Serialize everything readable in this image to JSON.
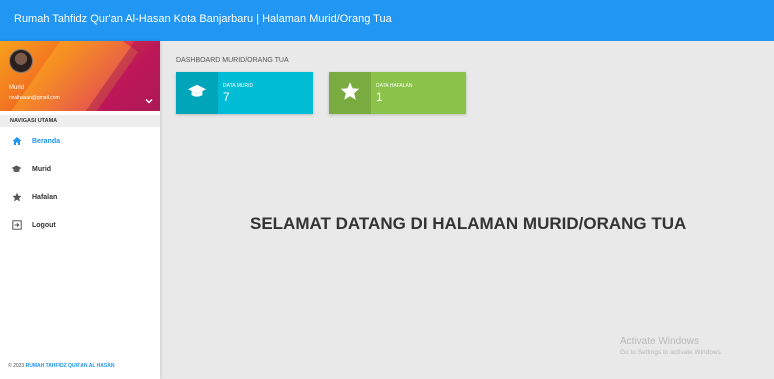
{
  "topbar": {
    "title": "Rumah Tahfidz Qur'an Al-Hasan Kota Banjarbaru | Halaman Murid/Orang Tua"
  },
  "user": {
    "name": "Murid",
    "email": "rizalhasan@gmail.com"
  },
  "nav": {
    "header": "NAVIGASI UTAMA",
    "items": [
      {
        "label": "Beranda",
        "icon": "home-icon",
        "active": true
      },
      {
        "label": "Murid",
        "icon": "graduation-cap-icon"
      },
      {
        "label": "Hafalan",
        "icon": "star-icon"
      },
      {
        "label": "Logout",
        "icon": "logout-icon"
      }
    ]
  },
  "footer": {
    "prefix": "© 2023 ",
    "brand": "RUMAH TAHFIDZ QUR'AN AL HASAN"
  },
  "main": {
    "heading": "DASHBOARD MURID/ORANG TUA",
    "boxes": [
      {
        "label": "DATA MURID",
        "value": "7",
        "color": "#00bcd4",
        "icon": "graduation-cap-icon"
      },
      {
        "label": "DATA HAFALAN",
        "value": "1",
        "color": "#8bc34a",
        "icon": "star-icon"
      }
    ],
    "welcome": "SELAMAT DATANG DI HALAMAN MURID/ORANG TUA"
  },
  "watermark": {
    "line1": "Activate Windows",
    "line2": "Go to Settings to activate Windows."
  },
  "colors": {
    "primary": "#2196f3",
    "cyan": "#00bcd4",
    "green": "#8bc34a"
  }
}
